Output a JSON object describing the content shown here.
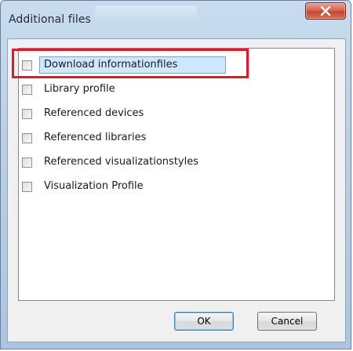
{
  "window": {
    "title": "Additional files",
    "close_icon": "close-icon"
  },
  "files": {
    "items": [
      {
        "label": "Download informationfiles",
        "checked": false,
        "selected": true
      },
      {
        "label": "Library profile",
        "checked": false,
        "selected": false
      },
      {
        "label": "Referenced devices",
        "checked": false,
        "selected": false
      },
      {
        "label": "Referenced libraries",
        "checked": false,
        "selected": false
      },
      {
        "label": "Referenced visualizationstyles",
        "checked": false,
        "selected": false
      },
      {
        "label": "Visualization Profile",
        "checked": false,
        "selected": false
      }
    ]
  },
  "buttons": {
    "ok_label": "OK",
    "cancel_label": "Cancel"
  },
  "colors": {
    "highlight": "#e3192b",
    "selection": "#cde8ff",
    "close_button": "#c44730"
  }
}
